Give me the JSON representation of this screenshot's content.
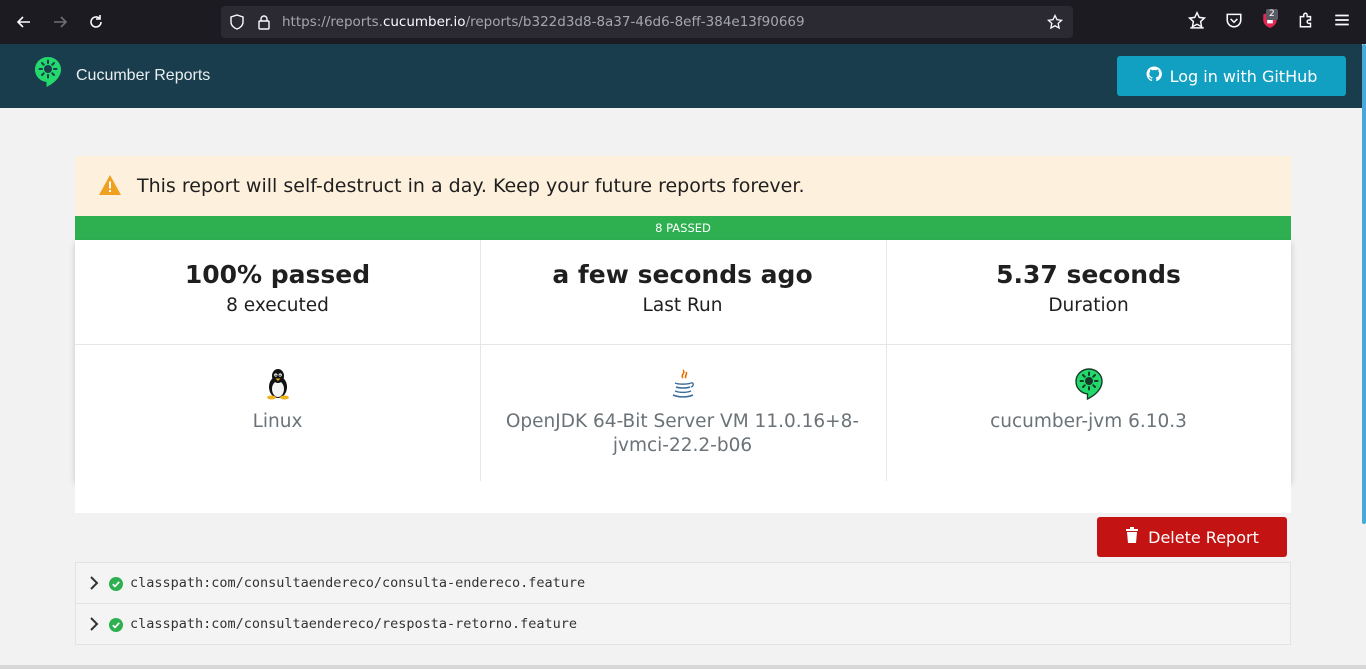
{
  "browser": {
    "url_prefix": "https://reports.",
    "url_domain": "cucumber.io",
    "url_path": "/reports/b322d3d8-8a37-46d6-8eff-384e13f90669",
    "extension_badge": "2",
    "icons": [
      "back-arrow-icon",
      "forward-arrow-icon",
      "reload-icon",
      "shield-icon",
      "lock-icon",
      "star-icon",
      "bookmark-star-icon",
      "pocket-icon",
      "extension-icon",
      "puzzle-icon",
      "menu-icon"
    ]
  },
  "header": {
    "brand": "Cucumber Reports",
    "login_label": "Log in with GitHub",
    "colors": {
      "bar": "#1a3d4e",
      "login": "#119fc2",
      "logo": "#23d96c"
    }
  },
  "banner": {
    "message": "This report will self-destruct in a day. Keep your future reports forever."
  },
  "status": {
    "passed_label": "8 PASSED",
    "color": "#2eb051"
  },
  "summary": {
    "passed_title": "100% passed",
    "passed_sub": "8 executed",
    "last_run_title": "a few seconds ago",
    "last_run_sub": "Last Run",
    "duration_title": "5.37 seconds",
    "duration_sub": "Duration"
  },
  "environment": {
    "os": "Linux",
    "runtime_line1": "OpenJDK 64-Bit Server VM 11.0.16+8-",
    "runtime_line2": "jvmci-22.2-b06",
    "implementation": "cucumber-jvm 6.10.3"
  },
  "actions": {
    "delete_label": "Delete Report",
    "delete_color": "#c41313"
  },
  "features": [
    {
      "path": "classpath:com/consultaendereco/consulta-endereco.feature",
      "status": "passed"
    },
    {
      "path": "classpath:com/consultaendereco/resposta-retorno.feature",
      "status": "passed"
    }
  ]
}
